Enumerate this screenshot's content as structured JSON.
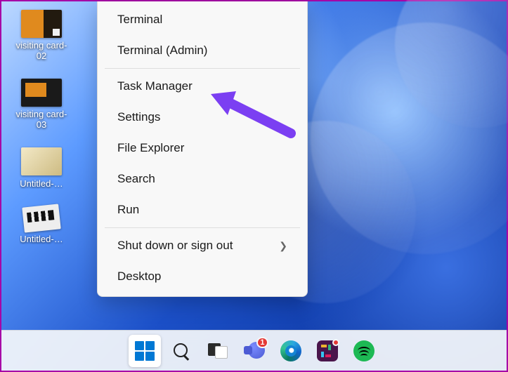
{
  "desktop": {
    "icons": [
      {
        "label": "visiting card-02",
        "thumbClass": "card02",
        "wrap": true
      },
      {
        "label": "visiting card-03",
        "thumbClass": "card03",
        "wrap": true
      },
      {
        "label": "Untitled-…",
        "thumbClass": "unt1",
        "wrap": false
      },
      {
        "label": "Untitled-…",
        "thumbClass": "unt2",
        "wrap": false
      }
    ]
  },
  "context_menu": {
    "groups": [
      {
        "items": [
          {
            "label": "Terminal",
            "submenu": false
          },
          {
            "label": "Terminal (Admin)",
            "submenu": false
          }
        ]
      },
      {
        "items": [
          {
            "label": "Task Manager",
            "submenu": false,
            "highlighted_by_arrow": true
          }
        ]
      },
      {
        "items": [
          {
            "label": "Settings",
            "submenu": false
          },
          {
            "label": "File Explorer",
            "submenu": false
          },
          {
            "label": "Search",
            "submenu": false
          },
          {
            "label": "Run",
            "submenu": false
          }
        ]
      },
      {
        "items": [
          {
            "label": "Shut down or sign out",
            "submenu": true
          },
          {
            "label": "Desktop",
            "submenu": false
          }
        ]
      }
    ]
  },
  "taskbar": {
    "items": [
      {
        "name": "start",
        "selected": true,
        "badge": null
      },
      {
        "name": "search",
        "selected": false,
        "badge": null
      },
      {
        "name": "task-view",
        "selected": false,
        "badge": null
      },
      {
        "name": "teams",
        "selected": false,
        "badge": "1"
      },
      {
        "name": "edge",
        "selected": false,
        "badge": null
      },
      {
        "name": "slack",
        "selected": false,
        "badge": " "
      },
      {
        "name": "spotify",
        "selected": false,
        "badge": null
      }
    ]
  },
  "annotation": {
    "arrow_color": "#7b3ff2"
  }
}
